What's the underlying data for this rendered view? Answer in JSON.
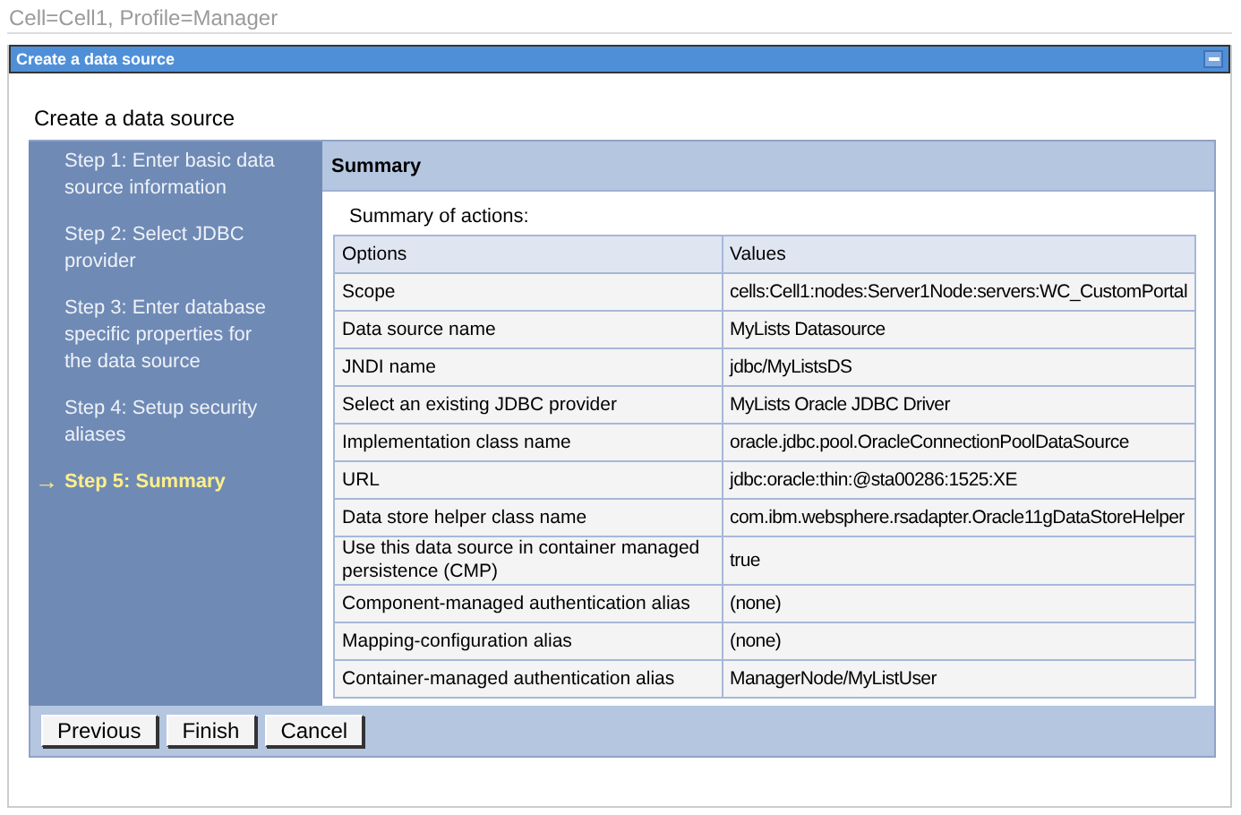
{
  "breadcrumb": "Cell=Cell1, Profile=Manager",
  "portlet": {
    "title": "Create a data source"
  },
  "heading": "Create a data source",
  "steps": [
    {
      "label": "Step 1: Enter basic data source information",
      "selected": false
    },
    {
      "label": "Step 2: Select JDBC provider",
      "selected": false
    },
    {
      "label": "Step 3: Enter database specific properties for the data source",
      "selected": false
    },
    {
      "label": "Step 4: Setup security aliases",
      "selected": false
    },
    {
      "label": "Step 5: Summary",
      "selected": true
    }
  ],
  "current_marker": "→",
  "summary": {
    "title": "Summary",
    "caption": "Summary of actions:",
    "columns": [
      "Options",
      "Values"
    ],
    "rows": [
      [
        "Scope",
        "cells:Cell1:nodes:Server1Node:servers:WC_CustomPortal"
      ],
      [
        "Data source name",
        "MyLists Datasource"
      ],
      [
        "JNDI name",
        "jdbc/MyListsDS"
      ],
      [
        "Select an existing JDBC provider",
        "MyLists Oracle JDBC Driver"
      ],
      [
        "Implementation class name",
        "oracle.jdbc.pool.OracleConnectionPoolDataSource"
      ],
      [
        "URL",
        "jdbc:oracle:thin:@sta00286:1525:XE"
      ],
      [
        "Data store helper class name",
        "com.ibm.websphere.rsadapter.Oracle11gDataStoreHelper"
      ],
      [
        "Use this data source in container managed persistence (CMP)",
        "true"
      ],
      [
        "Component-managed authentication alias",
        "(none)"
      ],
      [
        "Mapping-configuration alias",
        "(none)"
      ],
      [
        "Container-managed authentication alias",
        "ManagerNode/MyListUser"
      ]
    ]
  },
  "buttons": [
    "Previous",
    "Finish",
    "Cancel"
  ]
}
